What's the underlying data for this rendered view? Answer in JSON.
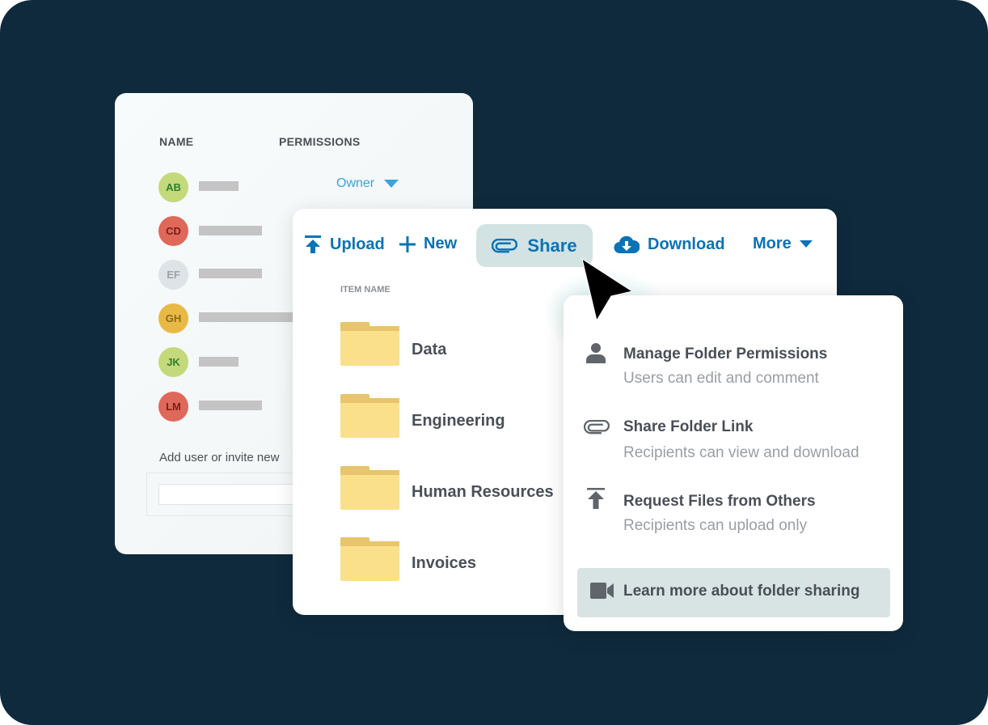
{
  "permissions_panel": {
    "name_header": "NAME",
    "permissions_header": "PERMISSIONS",
    "users": [
      {
        "initials": "AB",
        "color": "#c3d97a",
        "text_color": "#2e7d32"
      },
      {
        "initials": "CD",
        "color": "#e0685a",
        "text_color": "#7a1f15"
      },
      {
        "initials": "EF",
        "color": "#dde3e6",
        "text_color": "#9aa4ab"
      },
      {
        "initials": "GH",
        "color": "#e9b945",
        "text_color": "#8a6a1d"
      },
      {
        "initials": "JK",
        "color": "#c3d97a",
        "text_color": "#2e7d32"
      },
      {
        "initials": "LM",
        "color": "#e0685a",
        "text_color": "#7a1f15"
      }
    ],
    "owner_permission": "Owner",
    "add_user_label": "Add user or invite new"
  },
  "toolbar": {
    "upload": "Upload",
    "new": "New",
    "share": "Share",
    "download": "Download",
    "more": "More",
    "accent": "#0a73b5"
  },
  "file_list": {
    "column_header": "ITEM NAME",
    "folders": [
      "Data",
      "Engineering",
      "Human Resources",
      "Invoices"
    ]
  },
  "share_menu": {
    "items": [
      {
        "title": "Manage Folder Permissions",
        "subtitle": "Users can edit and comment",
        "icon": "person-icon"
      },
      {
        "title": "Share Folder Link",
        "subtitle": "Recipients can view and download",
        "icon": "paperclip-icon"
      },
      {
        "title": "Request Files from Others",
        "subtitle": "Recipients can upload only",
        "icon": "upload-icon"
      }
    ],
    "learn_more": "Learn more about folder sharing"
  }
}
